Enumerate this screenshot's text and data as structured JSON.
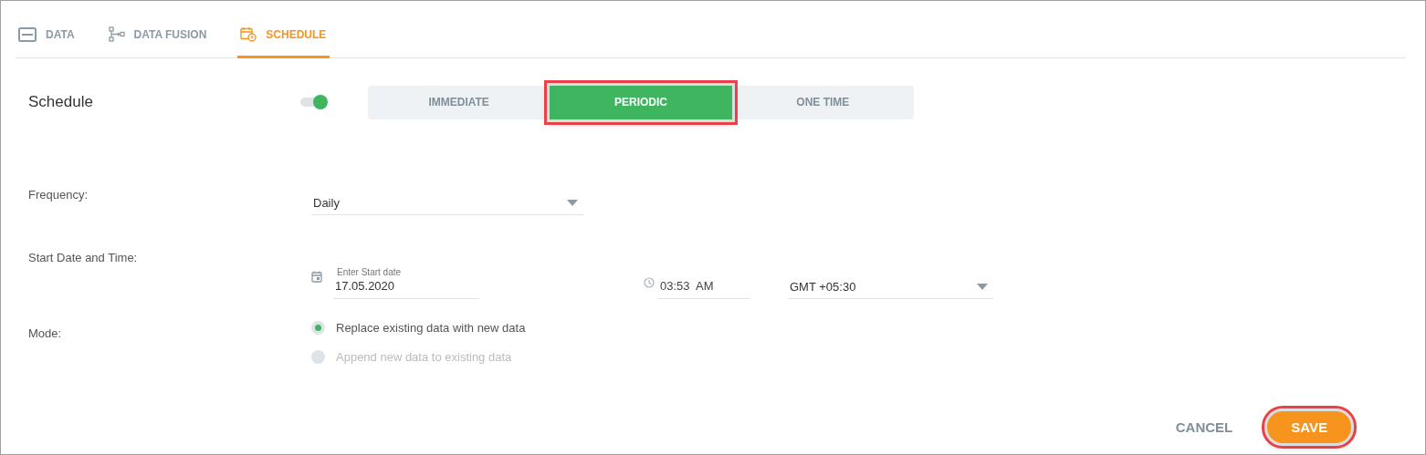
{
  "tabs": [
    {
      "label": "DATA",
      "kind": "card",
      "selected": false
    },
    {
      "label": "DATA FUSION",
      "kind": "flow",
      "selected": false
    },
    {
      "label": "SCHEDULE",
      "kind": "calendar",
      "selected": true
    }
  ],
  "schedule": {
    "label": "Schedule",
    "on": true,
    "options": [
      {
        "label": "IMMEDIATE",
        "selected": false,
        "highlighted": false
      },
      {
        "label": "PERIODIC",
        "selected": true,
        "highlighted": true
      },
      {
        "label": "ONE TIME",
        "selected": false,
        "highlighted": false
      }
    ]
  },
  "frequency": {
    "label": "Frequency:",
    "value": "Daily"
  },
  "start": {
    "label": "Start Date and Time:",
    "date_label": "Enter Start date",
    "date": "17.05.2020",
    "time": "03:53  AM",
    "timezone": "GMT +05:30"
  },
  "mode": {
    "label": "Mode:",
    "options": [
      {
        "label": "Replace existing data with new data",
        "selected": true,
        "disabled": false
      },
      {
        "label": "Append new data to existing data",
        "selected": false,
        "disabled": true
      }
    ]
  },
  "actions": [
    {
      "label": "CANCEL",
      "kind": "text",
      "highlighted": false
    },
    {
      "label": "SAVE",
      "kind": "primary",
      "highlighted": true
    }
  ]
}
